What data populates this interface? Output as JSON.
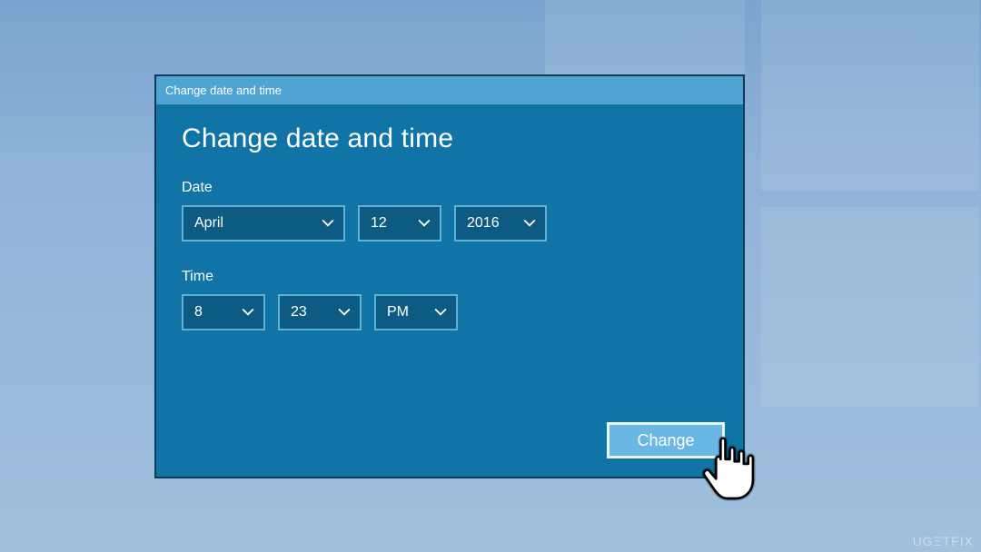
{
  "window": {
    "title": "Change date and time"
  },
  "heading": "Change date and time",
  "date": {
    "label": "Date",
    "month": "April",
    "day": "12",
    "year": "2016"
  },
  "time": {
    "label": "Time",
    "hour": "8",
    "minute": "23",
    "period": "PM"
  },
  "buttons": {
    "change": "Change"
  },
  "watermark": "UGΞTFIX"
}
